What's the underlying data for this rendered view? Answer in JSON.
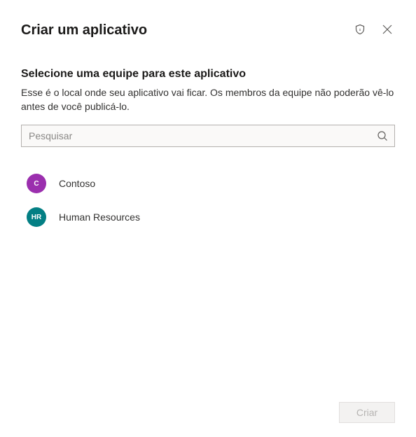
{
  "header": {
    "title": "Criar um aplicativo"
  },
  "section": {
    "title": "Selecione uma equipe para este aplicativo",
    "description": "Esse é o local onde seu aplicativo vai ficar. Os membros da equipe não poderão vê-lo antes de você publicá-lo."
  },
  "search": {
    "placeholder": "Pesquisar",
    "value": ""
  },
  "teams": [
    {
      "initials": "C",
      "name": "Contoso",
      "color": "#9b2fae"
    },
    {
      "initials": "HR",
      "name": "Human Resources",
      "color": "#037f84"
    }
  ],
  "footer": {
    "create_label": "Criar"
  }
}
